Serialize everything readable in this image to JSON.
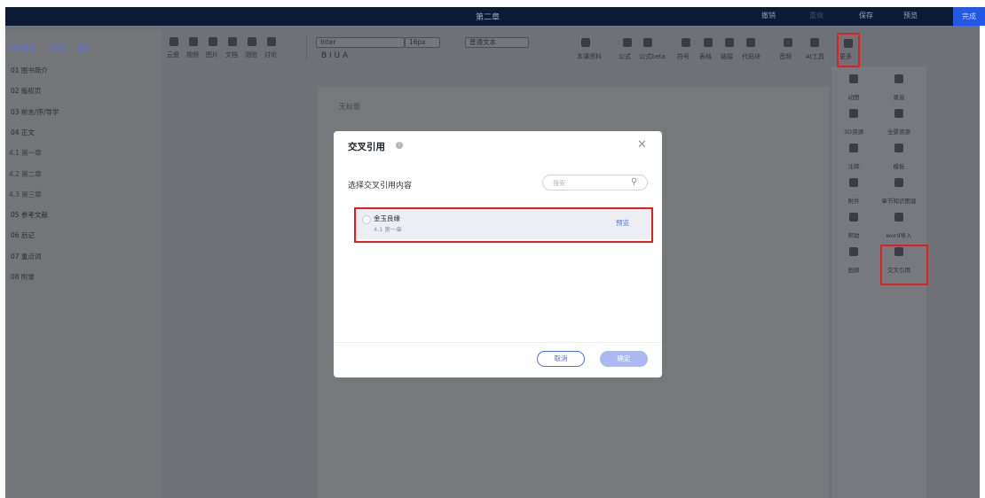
{
  "header": {
    "title": "第二章",
    "sync_label": "撤销",
    "redo_label": "重做",
    "save_label": "保存",
    "preview_label": "预览",
    "done_label": "完成"
  },
  "sidebar": {
    "actions": [
      "同级目录",
      "子目录",
      "更多"
    ],
    "items": [
      {
        "label": "01 图书简介",
        "sub": false
      },
      {
        "label": "02 版权页",
        "sub": false
      },
      {
        "label": "03 前言/序/导学",
        "sub": false
      },
      {
        "label": "04 正文",
        "sub": false
      },
      {
        "label": "4.1 第一章",
        "sub": true
      },
      {
        "label": "4.2 第二章",
        "sub": true
      },
      {
        "label": "4.3 第三章",
        "sub": true
      },
      {
        "label": "05 参考文献",
        "sub": false
      },
      {
        "label": "06 后记",
        "sub": false
      },
      {
        "label": "07 重点词",
        "sub": false
      },
      {
        "label": "08 附录",
        "sub": false
      }
    ]
  },
  "toolbar": {
    "insert_items": [
      "云盘",
      "视频",
      "图片",
      "文档",
      "测验",
      "讨论"
    ],
    "font_family": "Inter",
    "font_size": "16px",
    "paragraph_style": "普通文本",
    "format_row": "B  I  U  A",
    "extra_items": [
      "本课资料",
      "公式",
      "公式beta",
      "符号",
      "表格",
      "链接",
      "代码块",
      "音频",
      "AI工具"
    ],
    "more_label": "更多"
  },
  "editor": {
    "title_placeholder": "无标题"
  },
  "more_panel": {
    "items": [
      "动图",
      "录音",
      "3D资源",
      "全景资源",
      "注释",
      "模板",
      "附件",
      "章节知识图谱",
      "帮助",
      "word导入",
      "画廊",
      "交叉引用"
    ]
  },
  "modal": {
    "title": "交叉引用",
    "subtitle": "选择交叉引用内容",
    "search_placeholder": "搜索",
    "results": [
      {
        "title": "金玉良缘",
        "subtitle": "4.1 第一章",
        "action": "预览"
      }
    ],
    "cancel_label": "取消",
    "confirm_label": "确定"
  },
  "colors": {
    "accent": "#2357e8",
    "highlight": "#e02020",
    "topbar": "#0c1a36"
  }
}
